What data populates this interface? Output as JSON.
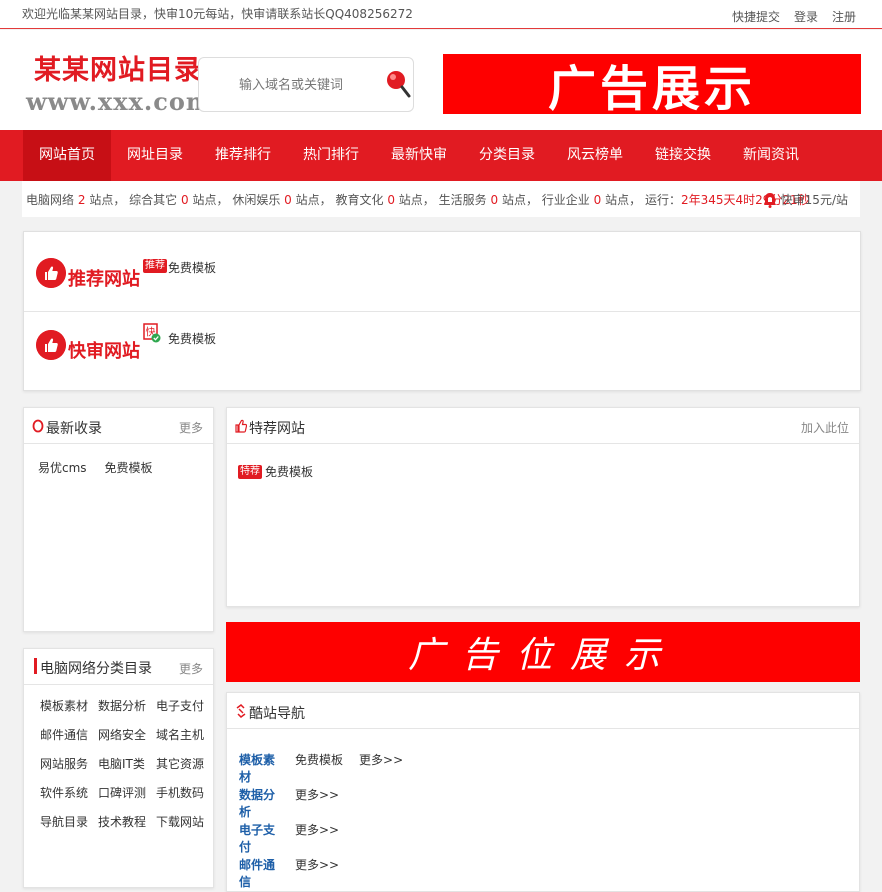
{
  "topbar": {
    "welcome": "欢迎光临某某网站目录，快审10元每站，快审请联系站长QQ408256272",
    "links": [
      "快捷提交",
      "登录",
      "注册"
    ]
  },
  "header": {
    "logo_main": "某某网站目录",
    "logo_url": "www.xxx.com",
    "search_placeholder": "输入域名或关键词",
    "ad_text": "广告展示"
  },
  "nav": {
    "items": [
      "网站首页",
      "网址目录",
      "推荐排行",
      "热门排行",
      "最新快审",
      "分类目录",
      "风云榜单",
      "链接交换",
      "新闻资讯"
    ],
    "active_index": 0
  },
  "stats": {
    "segments": [
      {
        "label": "电脑网络",
        "count": "2",
        "unit": "站点，"
      },
      {
        "label": "综合其它",
        "count": "0",
        "unit": "站点，"
      },
      {
        "label": "休闲娱乐",
        "count": "0",
        "unit": "站点，"
      },
      {
        "label": "教育文化",
        "count": "0",
        "unit": "站点，"
      },
      {
        "label": "生活服务",
        "count": "0",
        "unit": "站点，"
      },
      {
        "label": "行业企业",
        "count": "0",
        "unit": "站点，"
      }
    ],
    "runtime_label": "运行：",
    "runtime_value": "2年345天4时29分21秒",
    "fast_review": "快审15元/站"
  },
  "recommend": {
    "title": "推荐网站",
    "badge": "推荐",
    "link": "免费模板"
  },
  "fast": {
    "title": "快审网站",
    "badge": "快",
    "link": "免费模板"
  },
  "newest": {
    "title": "最新收录",
    "more": "更多",
    "items": [
      "易优cms",
      "免费模板"
    ]
  },
  "featured": {
    "title": "特荐网站",
    "more": "加入此位",
    "badge": "特荐",
    "link": "免费模板"
  },
  "ad2": {
    "text": "广告位展示"
  },
  "category": {
    "title": "电脑网络分类目录",
    "more": "更多",
    "items": [
      "模板素材",
      "数据分析",
      "电子支付",
      "邮件通信",
      "网络安全",
      "域名主机",
      "网站服务",
      "电脑IT类",
      "其它资源",
      "软件系统",
      "口碑评测",
      "手机数码",
      "导航目录",
      "技术教程",
      "下载网站"
    ]
  },
  "coolnav": {
    "title": "酷站导航",
    "rows": [
      {
        "cat": "模板素材",
        "links": [
          "免费模板",
          "更多>>"
        ]
      },
      {
        "cat": "数据分析",
        "links": [
          "更多>>"
        ]
      },
      {
        "cat": "电子支付",
        "links": [
          "更多>>"
        ]
      },
      {
        "cat": "邮件通信",
        "links": [
          "更多>>"
        ]
      }
    ]
  },
  "colors": {
    "brand": "#e11b22",
    "ad": "#fe0000",
    "link_blue": "#1e5fa8"
  }
}
